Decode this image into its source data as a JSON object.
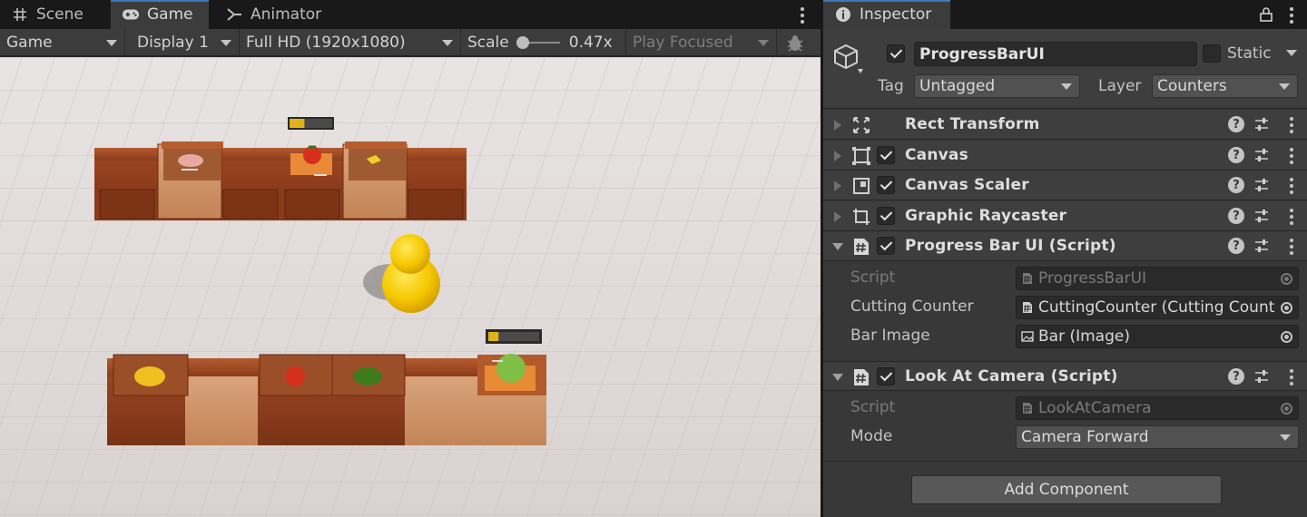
{
  "game_panel": {
    "tabs": [
      {
        "label": "Scene",
        "icon": "grid-icon"
      },
      {
        "label": "Game",
        "icon": "gamepad-icon"
      },
      {
        "label": "Animator",
        "icon": "animator-icon"
      }
    ],
    "active_tab": "Game",
    "toolbar": {
      "view_mode": "Game",
      "display": "Display 1",
      "resolution": "Full HD (1920x1080)",
      "scale_label": "Scale",
      "scale_value": "0.47x",
      "scale_slider_fraction": 0.0,
      "play_mode": "Play Focused",
      "bug_icon": "bug-icon"
    },
    "progress_bars": [
      {
        "label": "top-counter-progress",
        "fill_fraction": 0.35
      },
      {
        "label": "bottom-counter-progress",
        "fill_fraction": 0.2
      }
    ]
  },
  "inspector": {
    "tab_label": "Inspector",
    "object": {
      "icon": "gameobject-cube-icon",
      "active": true,
      "name": "ProgressBarUI",
      "static_label": "Static",
      "static": false,
      "tag_label": "Tag",
      "tag_value": "Untagged",
      "layer_label": "Layer",
      "layer_value": "Counters"
    },
    "components": [
      {
        "title": "Rect Transform",
        "icon": "rect-transform-icon",
        "expanded": false,
        "has_checkbox": false
      },
      {
        "title": "Canvas",
        "icon": "canvas-icon",
        "expanded": false,
        "has_checkbox": true
      },
      {
        "title": "Canvas Scaler",
        "icon": "canvas-scaler-icon",
        "expanded": false,
        "has_checkbox": true
      },
      {
        "title": "Graphic Raycaster",
        "icon": "graphic-raycaster-icon",
        "expanded": false,
        "has_checkbox": true
      },
      {
        "title": "Progress Bar UI (Script)",
        "icon": "script-icon",
        "expanded": true,
        "has_checkbox": true,
        "properties": [
          {
            "label": "Script",
            "value": "ProgressBarUI",
            "value_icon": "script-icon",
            "disabled": true
          },
          {
            "label": "Cutting Counter",
            "value": "CuttingCounter (Cutting Counter)",
            "value_icon": "script-icon",
            "disabled": false
          },
          {
            "label": "Bar Image",
            "value": "Bar (Image)",
            "value_icon": "image-icon",
            "disabled": false
          }
        ]
      },
      {
        "title": "Look At Camera (Script)",
        "icon": "script-icon",
        "expanded": true,
        "has_checkbox": true,
        "properties": [
          {
            "label": "Script",
            "value": "LookAtCamera",
            "value_icon": "script-icon",
            "disabled": true
          },
          {
            "label": "Mode",
            "value": "Camera Forward",
            "type": "dropdown"
          }
        ]
      }
    ],
    "add_component_label": "Add Component"
  },
  "colors": {
    "accent_tab": "#3a79bb",
    "panel_bg": "#383838",
    "progress_fill": "#e0b416",
    "progress_bg": "#4a4a4a"
  }
}
